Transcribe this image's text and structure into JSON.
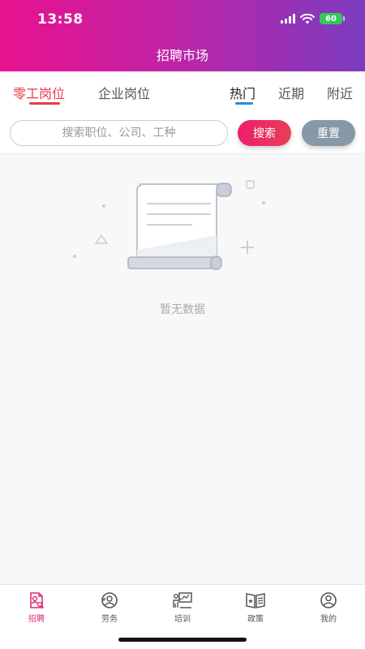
{
  "status": {
    "time": "13:58",
    "battery": "60"
  },
  "header": {
    "title": "招聘市场"
  },
  "job_tabs": [
    {
      "label": "零工岗位",
      "active": true
    },
    {
      "label": "企业岗位",
      "active": false
    }
  ],
  "sort_tabs": [
    {
      "label": "热门",
      "active": true
    },
    {
      "label": "近期",
      "active": false
    },
    {
      "label": "附近",
      "active": false
    }
  ],
  "search": {
    "placeholder": "搜索职位、公司、工种",
    "value": "",
    "search_label": "搜索",
    "reset_label": "重置"
  },
  "empty": {
    "text": "暂无数据"
  },
  "bottom_nav": [
    {
      "label": "招聘",
      "icon": "recruit-icon",
      "active": true
    },
    {
      "label": "劳务",
      "icon": "labor-icon",
      "active": false
    },
    {
      "label": "培训",
      "icon": "training-icon",
      "active": false
    },
    {
      "label": "政策",
      "icon": "policy-icon",
      "active": false
    },
    {
      "label": "我的",
      "icon": "profile-icon",
      "active": false
    }
  ],
  "colors": {
    "accent": "#e63b4a",
    "sort_accent": "#2a8ae6",
    "reset": "#8898a6",
    "nav_active": "#e0287a"
  }
}
